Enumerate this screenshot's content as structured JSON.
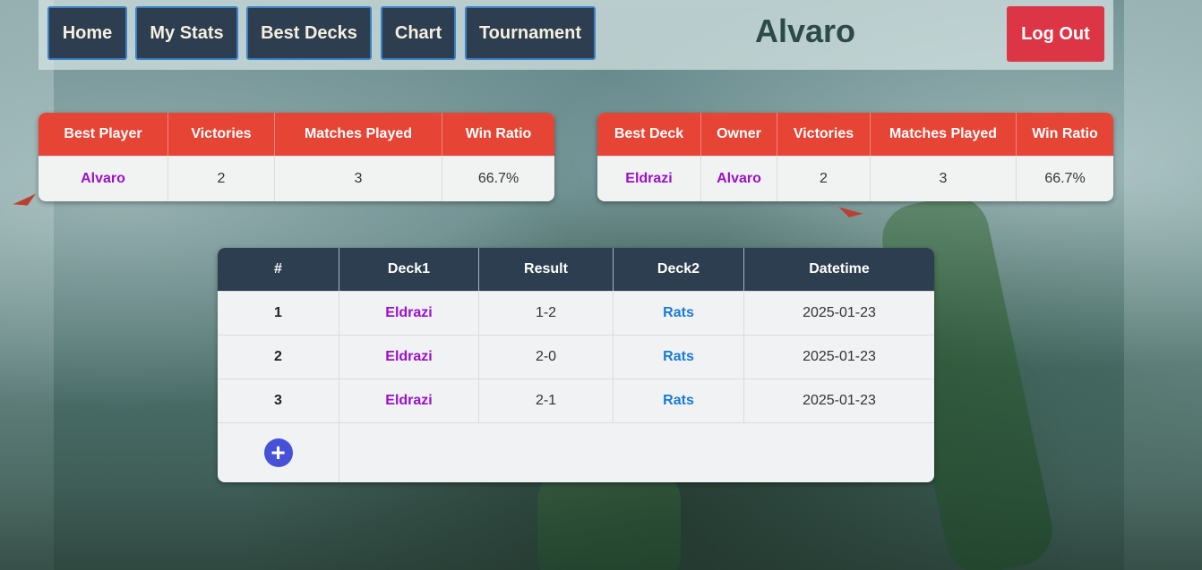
{
  "nav": {
    "items": [
      {
        "label": "Home"
      },
      {
        "label": "My Stats"
      },
      {
        "label": "Best Decks"
      },
      {
        "label": "Chart"
      },
      {
        "label": "Tournament"
      }
    ],
    "user_name": "Alvaro",
    "logout_label": "Log Out"
  },
  "best_player": {
    "headers": [
      "Best Player",
      "Victories",
      "Matches Played",
      "Win Ratio"
    ],
    "row": {
      "player": "Alvaro",
      "victories": "2",
      "matches": "3",
      "win_ratio": "66.7%"
    }
  },
  "best_deck": {
    "headers": [
      "Best Deck",
      "Owner",
      "Victories",
      "Matches Played",
      "Win Ratio"
    ],
    "row": {
      "deck": "Eldrazi",
      "owner": "Alvaro",
      "victories": "2",
      "matches": "3",
      "win_ratio": "66.7%"
    }
  },
  "matches": {
    "headers": [
      "#",
      "Deck1",
      "Result",
      "Deck2",
      "Datetime"
    ],
    "rows": [
      {
        "num": "1",
        "deck1": "Eldrazi",
        "result": "1-2",
        "deck2": "Rats",
        "datetime": "2025-01-23"
      },
      {
        "num": "2",
        "deck1": "Eldrazi",
        "result": "2-0",
        "deck2": "Rats",
        "datetime": "2025-01-23"
      },
      {
        "num": "3",
        "deck1": "Eldrazi",
        "result": "2-1",
        "deck2": "Rats",
        "datetime": "2025-01-23"
      }
    ],
    "add_icon": "plus-circle-icon"
  },
  "colors": {
    "nav_button_bg": "#2d3e50",
    "nav_button_border": "#3b82c4",
    "logout_bg": "#dc3545",
    "stat_header_bg": "#e64434",
    "match_header_bg": "#2d3e50",
    "link_purple": "#9a10c8",
    "link_blue": "#1a7ad6",
    "add_button": "#4651d8"
  }
}
